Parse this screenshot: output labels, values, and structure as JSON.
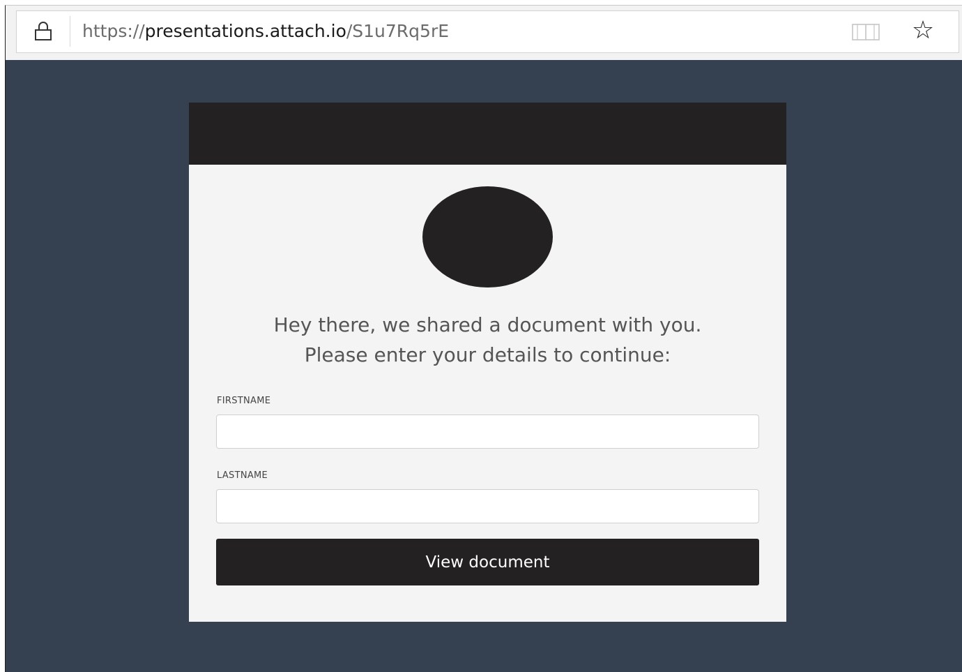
{
  "browser": {
    "url_scheme": "https://",
    "url_host": "presentations.attach.io",
    "url_path": "/S1u7Rq5rE",
    "icons": {
      "lock": "lock-icon",
      "reading_view": "reading-view-icon",
      "favorite": "star-icon"
    },
    "star_glyph": "☆"
  },
  "card": {
    "heading_line1": "Hey there, we shared a document with you.",
    "heading_line2": "Please enter your details to continue:",
    "firstname_label": "FIRSTNAME",
    "firstname_value": "",
    "lastname_label": "LASTNAME",
    "lastname_value": "",
    "submit_label": "View document"
  },
  "colors": {
    "page_background": "#354151",
    "card_header": "#232122",
    "card_background": "#f4f4f4",
    "button_background": "#232122"
  }
}
